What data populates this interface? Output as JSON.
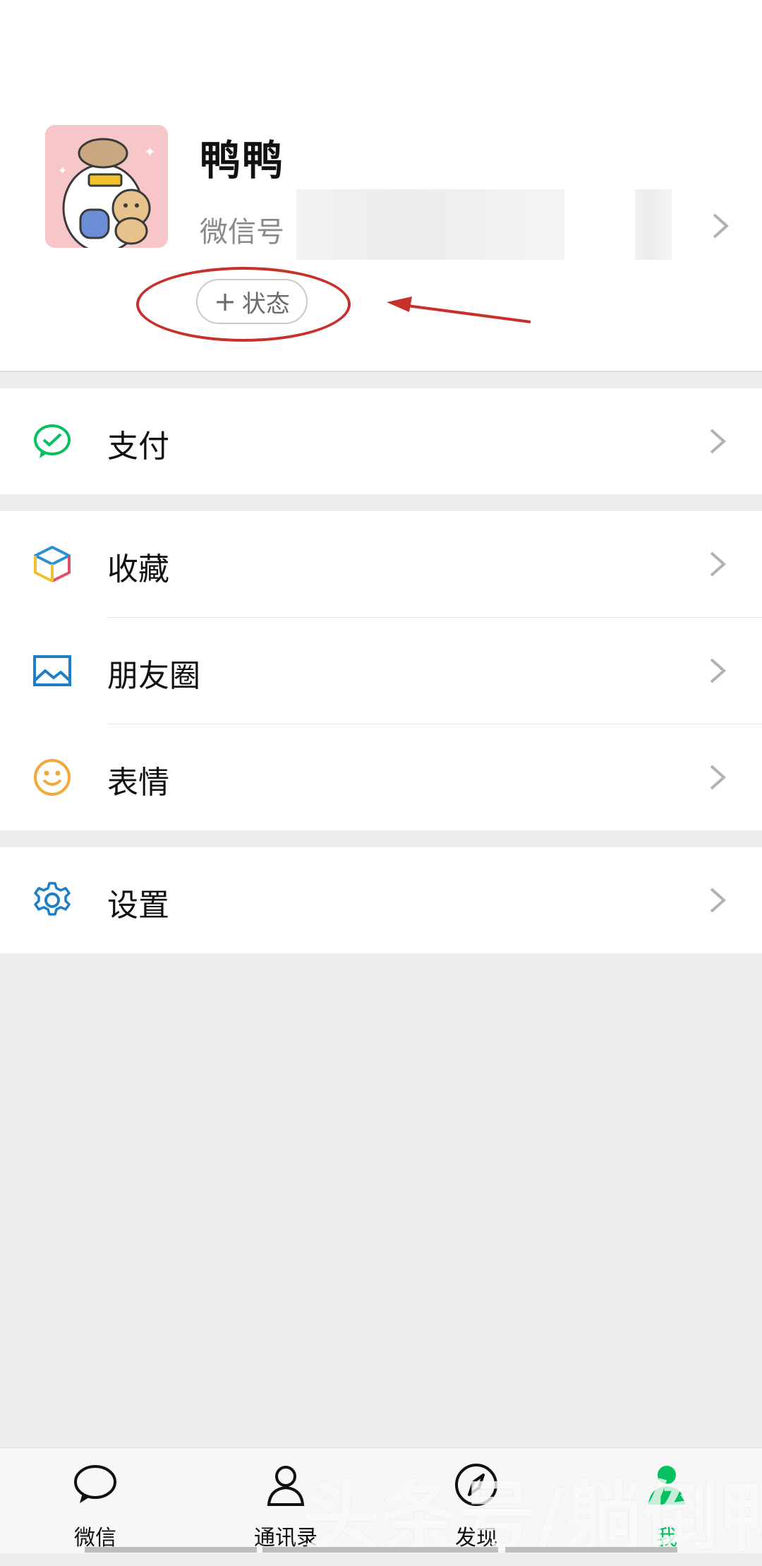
{
  "profile": {
    "nickname": "鸭鸭",
    "wechat_id_label": "微信号",
    "status_button": {
      "icon": "plus-icon",
      "label": "状态"
    }
  },
  "menu": {
    "pay": {
      "label": "支付",
      "icon": "pay-icon"
    },
    "favorites": {
      "label": "收藏",
      "icon": "favorites-cube-icon"
    },
    "moments": {
      "label": "朋友圈",
      "icon": "moments-image-icon"
    },
    "stickers": {
      "label": "表情",
      "icon": "smiley-icon"
    },
    "settings": {
      "label": "设置",
      "icon": "gear-icon"
    }
  },
  "tabbar": {
    "items": [
      {
        "label": "微信",
        "icon": "chat-bubble-icon",
        "active": false
      },
      {
        "label": "通讯录",
        "icon": "contacts-icon",
        "active": false
      },
      {
        "label": "发现",
        "icon": "compass-icon",
        "active": false
      },
      {
        "label": "我",
        "icon": "person-icon",
        "active": true
      }
    ]
  },
  "watermark": "头条号/躺倒鸭",
  "colors": {
    "accent_green": "#07c160",
    "annotation_red": "#c8312b",
    "background": "#ededed"
  }
}
